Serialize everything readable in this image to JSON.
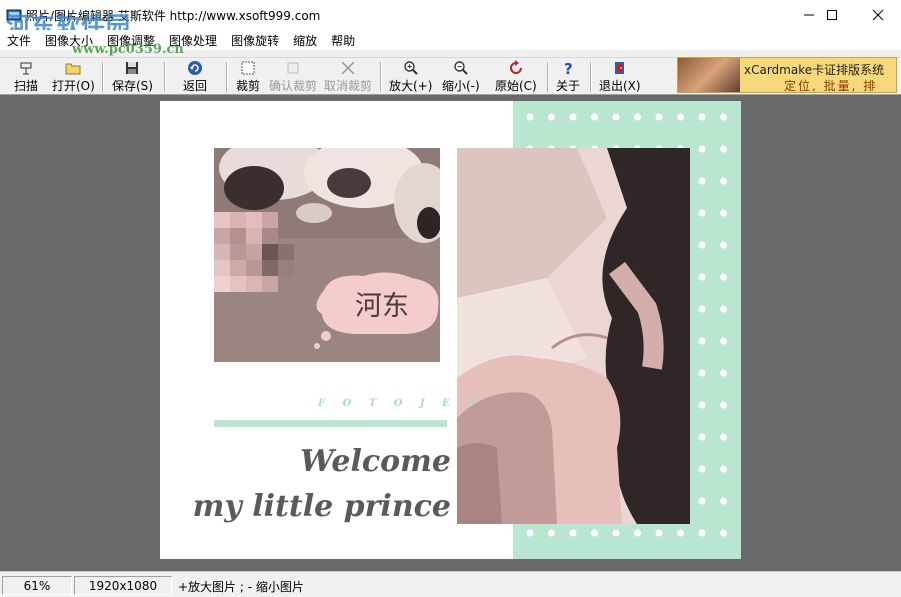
{
  "window": {
    "title": "照片/图片编辑器 艾斯软件 http://www.xsoft999.com",
    "watermark_name": "河东软件园",
    "watermark_url": "www.pc0359.cn"
  },
  "menu": [
    "文件",
    "图像大小",
    "图像调整",
    "图像处理",
    "图像旋转",
    "缩放",
    "帮助"
  ],
  "toolbar": {
    "scan": "扫描",
    "open": "打开(O)",
    "save": "保存(S)",
    "back": "返回",
    "crop": "裁剪",
    "confirm_crop": "确认裁剪",
    "cancel_crop": "取消裁剪",
    "zoom_in": "放大(+)",
    "zoom_out": "缩小(-)",
    "original": "原始(C)",
    "about": "关于",
    "exit": "退出(X)"
  },
  "ad": {
    "line1": "xCardmake卡证排版系统",
    "line2": "定位, 批量, 排"
  },
  "image": {
    "tag": "F O T O J E T",
    "welcome": "Welcome",
    "subtitle": "my little prince",
    "sticker_text": "河东"
  },
  "status": {
    "zoom": "61%",
    "dimensions": "1920x1080",
    "hint": "+放大图片 ; - 缩小图片"
  },
  "colors": {
    "accent_mint": "#b9e6cf",
    "workspace_gray": "#696969"
  }
}
